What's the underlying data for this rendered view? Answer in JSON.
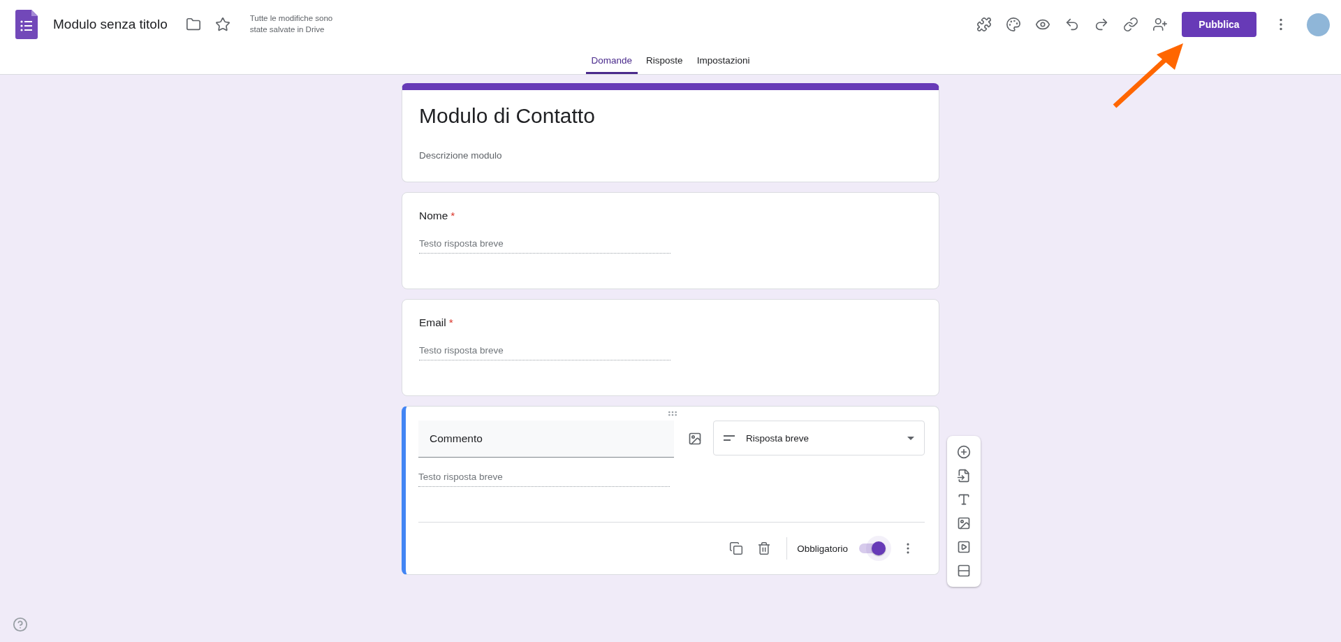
{
  "header": {
    "title": "Modulo senza titolo",
    "save_status": "Tutte le modifiche sono state salvate in Drive",
    "publish_button": "Pubblica"
  },
  "tabs": [
    {
      "label": "Domande",
      "selected": true
    },
    {
      "label": "Risposte",
      "selected": false
    },
    {
      "label": "Impostazioni",
      "selected": false
    }
  ],
  "form": {
    "title": "Modulo di Contatto",
    "description": "Descrizione modulo"
  },
  "questions": [
    {
      "kind": "static",
      "label": "Nome",
      "required": true,
      "required_mark": "*",
      "answer_placeholder": "Testo risposta breve"
    },
    {
      "kind": "static",
      "label": "Email",
      "required": true,
      "required_mark": "*",
      "answer_placeholder": "Testo risposta breve"
    },
    {
      "kind": "editing",
      "label": "Commento",
      "required": true,
      "answer_placeholder": "Testo risposta breve",
      "question_type": "Risposta breve",
      "required_label": "Obbligatorio"
    }
  ]
}
